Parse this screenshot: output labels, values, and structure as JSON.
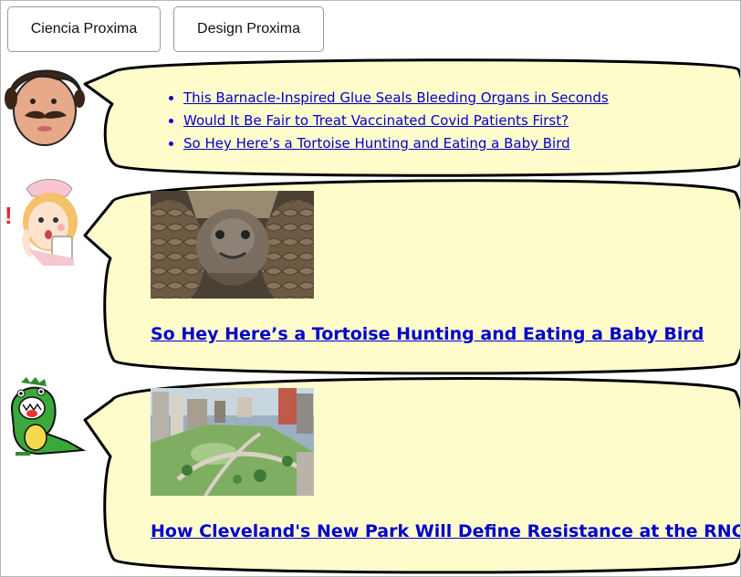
{
  "nav": {
    "tabs": [
      {
        "label": "Ciencia Proxima"
      },
      {
        "label": "Design Proxima"
      }
    ]
  },
  "colors": {
    "bubble_fill": "#fffccc",
    "bubble_stroke": "#000000",
    "link": "#0000cc"
  },
  "feed": {
    "bubble1": {
      "avatar_icon": "mustache-man-icon",
      "links": [
        {
          "text": "This Barnacle-Inspired Glue Seals Bleeding Organs in Seconds"
        },
        {
          "text": "Would It Be Fair to Treat Vaccinated Covid Patients First?"
        },
        {
          "text": "So Hey Here’s a Tortoise Hunting and Eating a Baby Bird"
        }
      ]
    },
    "bubble2": {
      "avatar_icon": "surprised-nurse-icon",
      "image": "tortoise-photo",
      "headline": "So Hey Here’s a Tortoise Hunting and Eating a Baby Bird"
    },
    "bubble3": {
      "avatar_icon": "green-dinosaur-icon",
      "image": "city-park-aerial-photo",
      "headline": "How Cleveland's New Park Will Define Resistance at the RNC"
    }
  }
}
